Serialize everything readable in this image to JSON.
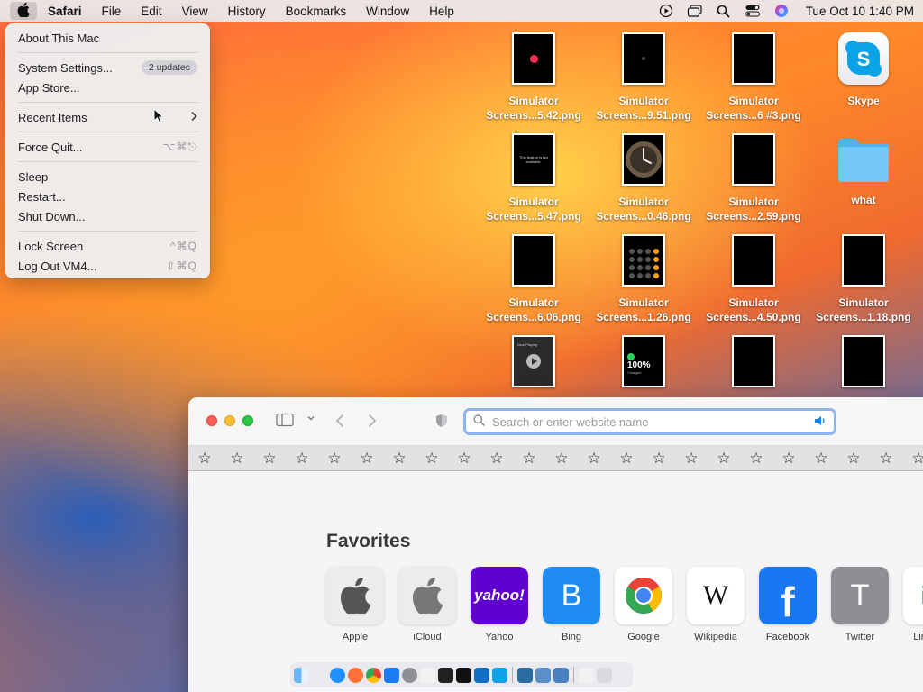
{
  "menubar": {
    "app_name": "Safari",
    "menus": [
      "File",
      "Edit",
      "View",
      "History",
      "Bookmarks",
      "Window",
      "Help"
    ],
    "clock": "Tue Oct 10  1:40 PM"
  },
  "apple_menu": {
    "about": "About This Mac",
    "system_settings": "System Settings...",
    "updates_badge": "2 updates",
    "app_store": "App Store...",
    "recent_items": "Recent Items",
    "force_quit": "Force Quit...",
    "force_quit_shortcut": "⌥⌘⎋",
    "sleep": "Sleep",
    "restart": "Restart...",
    "shut_down": "Shut Down...",
    "lock_screen": "Lock Screen",
    "lock_shortcut": "^⌘Q",
    "log_out": "Log Out VM4...",
    "log_out_shortcut": "⇧⌘Q"
  },
  "desktop": {
    "icons": [
      {
        "line1": "Simulator",
        "line2": "Screens...5.42.png"
      },
      {
        "line1": "Simulator",
        "line2": "Screens...9.51.png"
      },
      {
        "line1": "Simulator",
        "line2": "Screens...6 #3.png"
      },
      {
        "line1": "Skype",
        "line2": ""
      },
      {
        "line1": "Simulator",
        "line2": "Screens...5.47.png"
      },
      {
        "line1": "Simulator",
        "line2": "Screens...0.46.png"
      },
      {
        "line1": "Simulator",
        "line2": "Screens...2.59.png"
      },
      {
        "line1": "what",
        "line2": ""
      },
      {
        "line1": "Simulator",
        "line2": "Screens...6.06.png"
      },
      {
        "line1": "Simulator",
        "line2": "Screens...1.26.png"
      },
      {
        "line1": "Simulator",
        "line2": "Screens...4.50.png"
      },
      {
        "line1": "Simulator",
        "line2": "Screens...1.18.png"
      }
    ],
    "thumb_texts": {
      "not_available": "This feature is not available.",
      "battery_pct": "100%",
      "battery_sub": "Charged",
      "now_playing": "Now Playing"
    }
  },
  "safari": {
    "search_placeholder": "Search or enter website name",
    "favorites_title": "Favorites",
    "favorites": [
      {
        "label": "Apple",
        "glyph": "",
        "bg": "#ececee",
        "fg": "#555"
      },
      {
        "label": "iCloud",
        "glyph": "",
        "bg": "#ececee",
        "fg": "#777"
      },
      {
        "label": "Yahoo",
        "glyph": "yahoo!",
        "bg": "#6001d2",
        "fg": "#ffffff"
      },
      {
        "label": "Bing",
        "glyph": "B",
        "bg": "#1f8af0",
        "fg": "#ffffff"
      },
      {
        "label": "Google",
        "glyph": "",
        "bg": "#ffffff",
        "fg": "#000"
      },
      {
        "label": "Wikipedia",
        "glyph": "W",
        "bg": "#ffffff",
        "fg": "#111"
      },
      {
        "label": "Facebook",
        "glyph": "f",
        "bg": "#1877f2",
        "fg": "#ffffff"
      },
      {
        "label": "Twitter",
        "glyph": "T",
        "bg": "#8e8e93",
        "fg": "#ffffff"
      },
      {
        "label": "LinkedIn",
        "glyph": "in",
        "bg": "#ffffff",
        "fg": "#0a66c2"
      }
    ]
  },
  "colors": {
    "accent": "#0a84ff",
    "url_focus": "#8ab4f0"
  }
}
